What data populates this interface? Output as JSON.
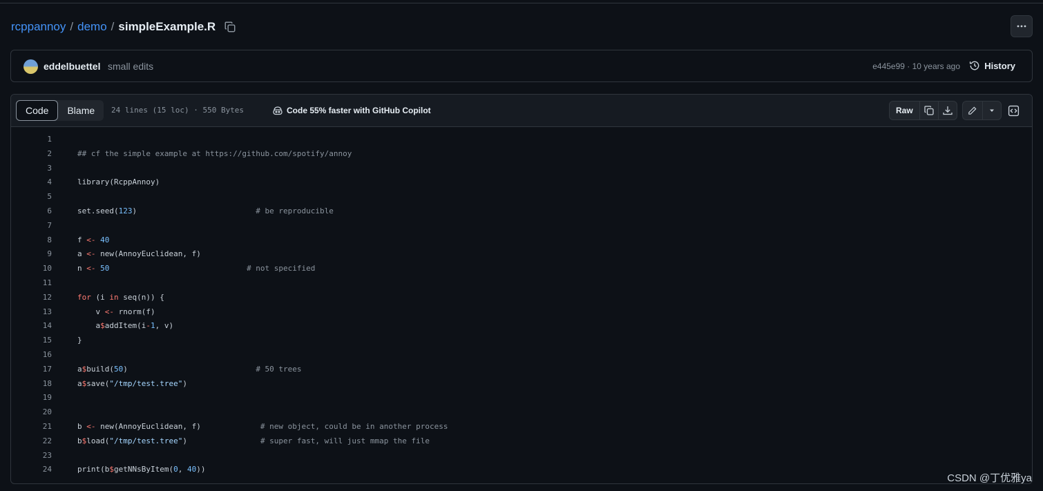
{
  "breadcrumb": {
    "repo": "rcppannoy",
    "sep1": "/",
    "folder": "demo",
    "sep2": "/",
    "file": "simpleExample.R"
  },
  "commit": {
    "author": "eddelbuettel",
    "message": "small edits",
    "sha_age": "e445e99 · 10 years ago",
    "history_label": "History"
  },
  "file_header": {
    "tabs": [
      "Code",
      "Blame"
    ],
    "meta": "24 lines (15 loc) · 550 Bytes",
    "copilot": "Code 55% faster with GitHub Copilot",
    "raw_label": "Raw"
  },
  "code_lines": [
    [],
    [
      [
        "c",
        "## cf the simple example at https://github.com/spotify/annoy"
      ]
    ],
    [],
    [
      [
        "p",
        "library(RcppAnnoy)"
      ]
    ],
    [],
    [
      [
        "p",
        "set.seed("
      ],
      [
        "n",
        "123"
      ],
      [
        "p",
        ")                          "
      ],
      [
        "c",
        "# be reproducible"
      ]
    ],
    [],
    [
      [
        "p",
        "f "
      ],
      [
        "k",
        "<-"
      ],
      [
        "p",
        " "
      ],
      [
        "n",
        "40"
      ]
    ],
    [
      [
        "p",
        "a "
      ],
      [
        "k",
        "<-"
      ],
      [
        "p",
        " new(AnnoyEuclidean, f)"
      ]
    ],
    [
      [
        "p",
        "n "
      ],
      [
        "k",
        "<-"
      ],
      [
        "p",
        " "
      ],
      [
        "n",
        "50"
      ],
      [
        "p",
        "                              "
      ],
      [
        "c",
        "# not specified"
      ]
    ],
    [],
    [
      [
        "k",
        "for"
      ],
      [
        "p",
        " (i "
      ],
      [
        "k",
        "in"
      ],
      [
        "p",
        " seq(n)) {"
      ]
    ],
    [
      [
        "p",
        "    v "
      ],
      [
        "k",
        "<-"
      ],
      [
        "p",
        " rnorm(f)"
      ]
    ],
    [
      [
        "p",
        "    a"
      ],
      [
        "k",
        "$"
      ],
      [
        "p",
        "addItem(i"
      ],
      [
        "k",
        "-"
      ],
      [
        "n",
        "1"
      ],
      [
        "p",
        ", v)"
      ]
    ],
    [
      [
        "p",
        "}"
      ]
    ],
    [],
    [
      [
        "p",
        "a"
      ],
      [
        "k",
        "$"
      ],
      [
        "p",
        "build("
      ],
      [
        "n",
        "50"
      ],
      [
        "p",
        ")                            "
      ],
      [
        "c",
        "# 50 trees"
      ]
    ],
    [
      [
        "p",
        "a"
      ],
      [
        "k",
        "$"
      ],
      [
        "p",
        "save("
      ],
      [
        "s",
        "\"/tmp/test.tree\""
      ],
      [
        "p",
        ")"
      ]
    ],
    [],
    [],
    [
      [
        "p",
        "b "
      ],
      [
        "k",
        "<-"
      ],
      [
        "p",
        " new(AnnoyEuclidean, f)             "
      ],
      [
        "c",
        "# new object, could be in another process"
      ]
    ],
    [
      [
        "p",
        "b"
      ],
      [
        "k",
        "$"
      ],
      [
        "p",
        "load("
      ],
      [
        "s",
        "\"/tmp/test.tree\""
      ],
      [
        "p",
        ")                "
      ],
      [
        "c",
        "# super fast, will just mmap the file"
      ]
    ],
    [],
    [
      [
        "p",
        "print(b"
      ],
      [
        "k",
        "$"
      ],
      [
        "p",
        "getNNsByItem("
      ],
      [
        "n",
        "0"
      ],
      [
        "p",
        ", "
      ],
      [
        "n",
        "40"
      ],
      [
        "p",
        "))"
      ]
    ]
  ],
  "watermark": "CSDN @丁优雅ya",
  "icons": {
    "copy_path": "copy-icon",
    "more": "kebab-horizontal-icon",
    "history": "history-icon",
    "copilot": "copilot-icon",
    "copy_raw": "copy-icon",
    "download": "download-icon",
    "edit": "pencil-icon",
    "dropdown": "triangle-down-icon",
    "symbols": "code-square-icon"
  },
  "colors": {
    "background": "#0d1117",
    "link": "#4493f8",
    "border": "#30363d",
    "keyword": "#ff7b72",
    "number": "#79c0ff",
    "comment": "#8b949e"
  }
}
